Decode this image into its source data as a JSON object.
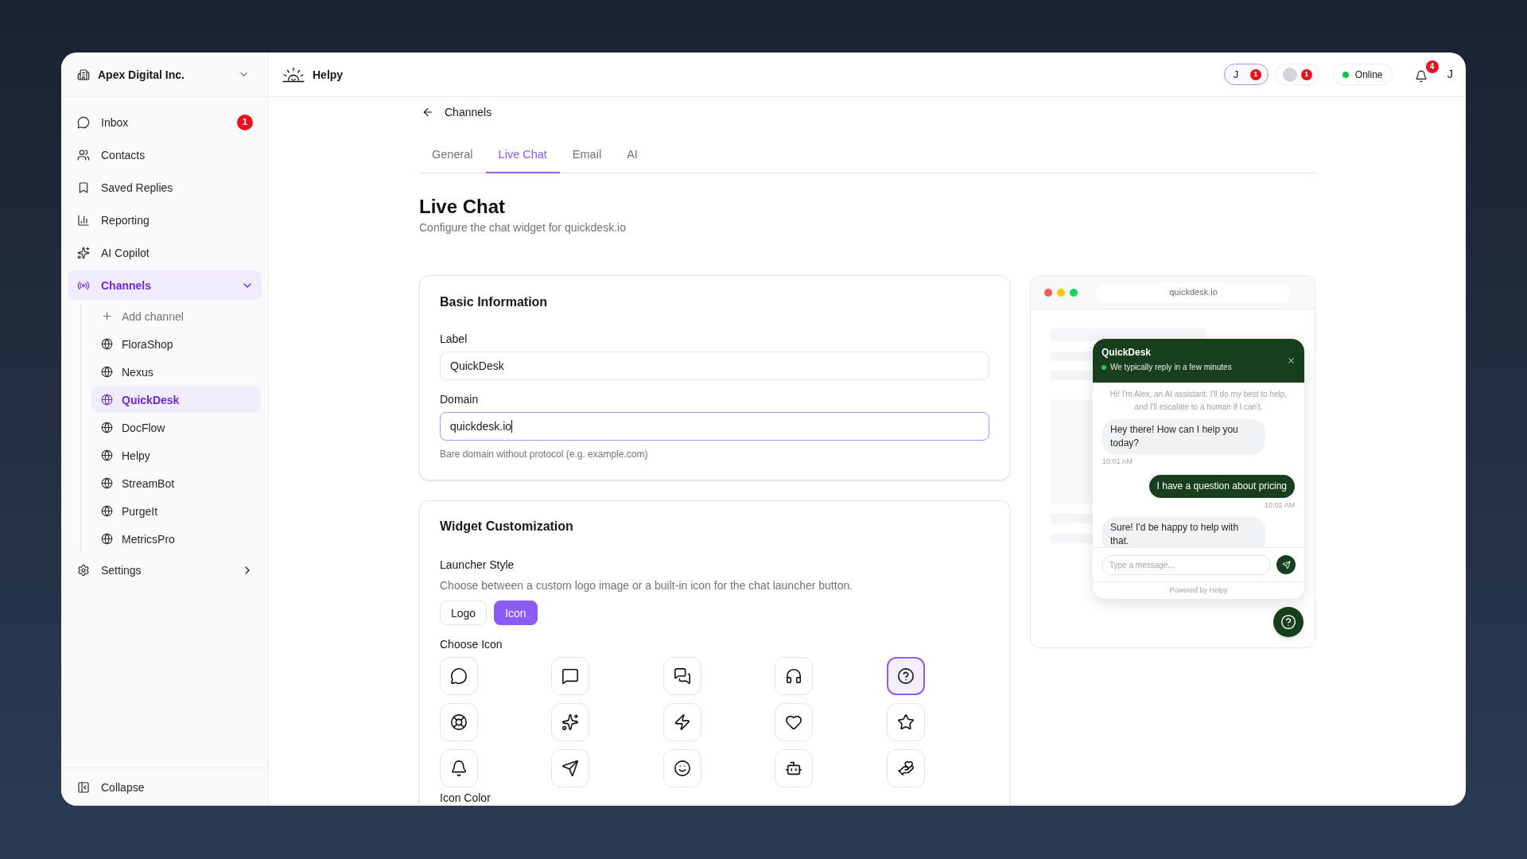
{
  "sidebar": {
    "org": {
      "name": "Apex Digital Inc."
    },
    "nav": [
      {
        "label": "Inbox",
        "selected": false,
        "badge": "1"
      },
      {
        "label": "Contacts",
        "selected": false
      },
      {
        "label": "Saved Replies",
        "selected": false
      },
      {
        "label": "Reporting",
        "selected": false
      },
      {
        "label": "AI Copilot",
        "selected": false
      },
      {
        "label": "Channels",
        "selected": true,
        "expanded": true,
        "children": [
          {
            "kind": "add",
            "label": "Add channel",
            "selected": false
          },
          {
            "kind": "channel",
            "label": "FloraShop",
            "selected": false
          },
          {
            "kind": "channel",
            "label": "Nexus",
            "selected": false
          },
          {
            "kind": "channel",
            "label": "QuickDesk",
            "selected": true
          },
          {
            "kind": "channel",
            "label": "DocFlow",
            "selected": false
          },
          {
            "kind": "channel",
            "label": "Helpy",
            "selected": false
          },
          {
            "kind": "channel",
            "label": "StreamBot",
            "selected": false
          },
          {
            "kind": "channel",
            "label": "PurgeIt",
            "selected": false
          },
          {
            "kind": "channel",
            "label": "MetricsPro",
            "selected": false
          }
        ]
      },
      {
        "label": "Settings",
        "selected": false,
        "expanded": false
      }
    ],
    "collapse": {
      "label": "Collapse"
    }
  },
  "topbar": {
    "app": {
      "name": "Helpy"
    },
    "agents": [
      {
        "kind": "initial",
        "initial": "J",
        "count": "1",
        "selected": true
      },
      {
        "kind": "photo",
        "count": "1",
        "selected": false
      }
    ],
    "status": {
      "label": "Online",
      "online": true
    },
    "notifications": {
      "count": "4"
    },
    "user": {
      "initial": "J"
    }
  },
  "breadcrumb": {
    "label": "Channels"
  },
  "tabs": [
    {
      "label": "General",
      "selected": false
    },
    {
      "label": "Live Chat",
      "selected": true
    },
    {
      "label": "Email",
      "selected": false
    },
    {
      "label": "AI",
      "selected": false
    }
  ],
  "page": {
    "title": "Live Chat",
    "subtitle": "Configure the chat widget for quickdesk.io"
  },
  "basic_information": {
    "title": "Basic Information",
    "fields": [
      {
        "label": "Label",
        "value": "QuickDesk",
        "focused": false
      },
      {
        "label": "Domain",
        "value": "quickdesk.io",
        "focused": true,
        "help_text": "Bare domain without protocol (e.g. example.com)"
      }
    ]
  },
  "widget_customization": {
    "title": "Widget Customization",
    "launcher_style": {
      "label": "Launcher Style",
      "description": "Choose between a custom logo image or a built-in icon for the chat launcher button.",
      "options": [
        {
          "label": "Logo",
          "selected": false
        },
        {
          "label": "Icon",
          "selected": true
        }
      ]
    },
    "choose_icon": {
      "label": "Choose Icon",
      "icons": [
        {
          "selected": false
        },
        {
          "selected": false
        },
        {
          "selected": false
        },
        {
          "selected": false
        },
        {
          "selected": true
        },
        {
          "selected": false
        },
        {
          "selected": false
        },
        {
          "selected": false
        },
        {
          "selected": false
        },
        {
          "selected": false
        },
        {
          "selected": false
        },
        {
          "selected": false
        },
        {
          "selected": false
        },
        {
          "selected": false
        },
        {
          "selected": false
        }
      ]
    },
    "icon_color": {
      "label": "Icon Color"
    }
  },
  "preview": {
    "url": "quickdesk.io",
    "widget": {
      "title": "QuickDesk",
      "subtitle": "We typically reply in a few minutes",
      "online": true,
      "messages": [
        {
          "kind": "system",
          "text": "Hi! I'm Alex, an AI assistant. I'll do my best to help, and I'll escalate to a human if I can't."
        },
        {
          "kind": "bot",
          "text": "Hey there! How can I help you today?",
          "time": "10:01 AM"
        },
        {
          "kind": "user",
          "text": "I have a question about pricing",
          "time": "10:02 AM"
        },
        {
          "kind": "bot",
          "text": "Sure! I'd be happy to help with that."
        }
      ],
      "input": {
        "placeholder": "Type a message..."
      },
      "footer": "Powered by Helpy"
    }
  }
}
